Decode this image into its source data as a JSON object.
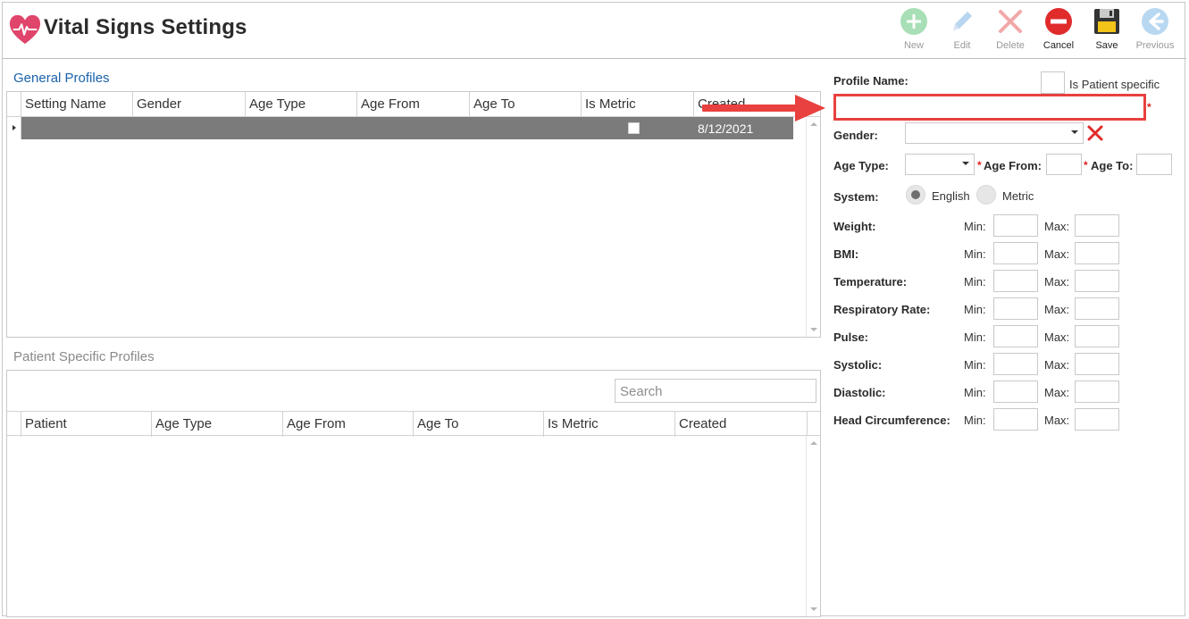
{
  "header": {
    "title": "Vital Signs Settings",
    "toolbar": [
      {
        "label": "New",
        "icon": "plus-circle-icon",
        "enabled": false
      },
      {
        "label": "Edit",
        "icon": "pencil-icon",
        "enabled": false
      },
      {
        "label": "Delete",
        "icon": "x-delete-icon",
        "enabled": false
      },
      {
        "label": "Cancel",
        "icon": "cancel-circle-icon",
        "enabled": true
      },
      {
        "label": "Save",
        "icon": "floppy-disk-icon",
        "enabled": true
      },
      {
        "label": "Previous",
        "icon": "arrow-left-circle-icon",
        "enabled": false
      }
    ]
  },
  "general_profiles": {
    "label": "General Profiles",
    "columns": [
      "Setting Name",
      "Gender",
      "Age Type",
      "Age From",
      "Age To",
      "Is Metric",
      "Created"
    ],
    "rows": [
      {
        "setting_name": "",
        "gender": "",
        "age_type": "",
        "age_from": "",
        "age_to": "",
        "is_metric": false,
        "created": "8/12/2021"
      }
    ]
  },
  "patient_specific_profiles": {
    "label": "Patient Specific Profiles",
    "search_placeholder": "Search",
    "columns": [
      "Patient",
      "Age Type",
      "Age From",
      "Age To",
      "Is Metric",
      "Created"
    ]
  },
  "form": {
    "profile_name_label": "Profile Name:",
    "is_patient_specific_label": "Is Patient specific",
    "profile_name_value": "",
    "required_mark": "*",
    "gender_label": "Gender:",
    "age_type_label": "Age Type:",
    "age_from_label": "Age From:",
    "age_to_label": "Age To:",
    "system_label": "System:",
    "system_options": [
      "English",
      "Metric"
    ],
    "system_selected": "English",
    "min_label": "Min:",
    "max_label": "Max:",
    "vitals": [
      "Weight:",
      "BMI:",
      "Temperature:",
      "Respiratory Rate:",
      "Pulse:",
      "Systolic:",
      "Diastolic:",
      "Head Circumference:"
    ]
  },
  "colors": {
    "accent_blue": "#1a63ad",
    "selected_row": "#7b7b7b",
    "annotation_red": "#e8413f",
    "heart": "#e0456b"
  }
}
